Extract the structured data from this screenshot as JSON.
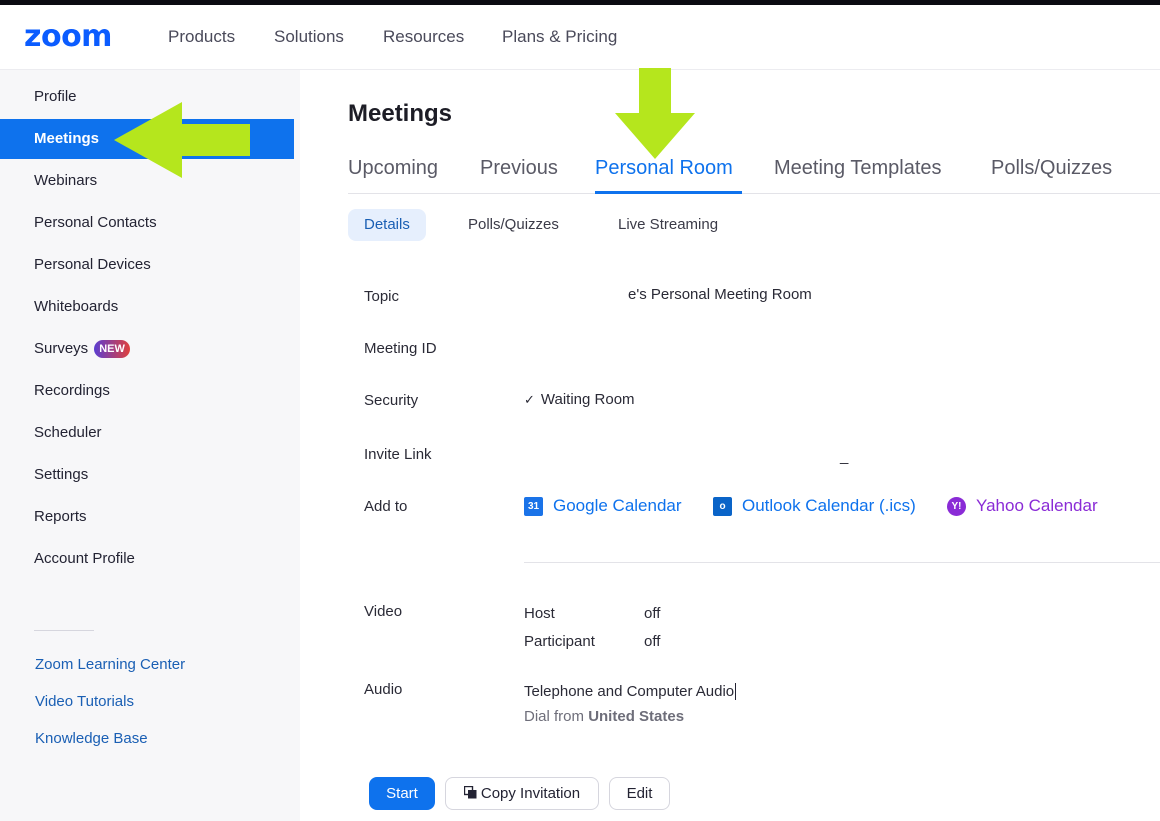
{
  "header": {
    "logo": "zoom",
    "nav": [
      "Products",
      "Solutions",
      "Resources",
      "Plans & Pricing"
    ]
  },
  "sidebar": {
    "items": [
      {
        "label": "Profile"
      },
      {
        "label": "Meetings",
        "active": true
      },
      {
        "label": "Webinars"
      },
      {
        "label": "Personal Contacts"
      },
      {
        "label": "Personal Devices"
      },
      {
        "label": "Whiteboards"
      },
      {
        "label": "Surveys",
        "badge": "NEW"
      },
      {
        "label": "Recordings"
      },
      {
        "label": "Scheduler"
      },
      {
        "label": "Settings"
      },
      {
        "label": "Reports"
      },
      {
        "label": "Account Profile"
      }
    ],
    "links": [
      "Zoom Learning Center",
      "Video Tutorials",
      "Knowledge Base"
    ]
  },
  "main": {
    "title": "Meetings",
    "tabs": [
      "Upcoming",
      "Previous",
      "Personal Room",
      "Meeting Templates",
      "Polls/Quizzes"
    ],
    "active_tab": "Personal Room",
    "subtabs": [
      "Details",
      "Polls/Quizzes",
      "Live Streaming"
    ],
    "active_subtab": "Details",
    "fields": {
      "topic_label": "Topic",
      "topic_value": "e's Personal Meeting Room",
      "meeting_id_label": "Meeting ID",
      "security_label": "Security",
      "security_check": "✓",
      "security_value": "Waiting Room",
      "invite_link_label": "Invite Link",
      "invite_link_value": "_",
      "add_to_label": "Add to",
      "calendars": [
        "Google Calendar",
        "Outlook Calendar (.ics)",
        "Yahoo Calendar"
      ],
      "calendar_icons": [
        "google-calendar-icon",
        "outlook-icon",
        "yahoo-icon"
      ],
      "google_icon_text": "31",
      "outlook_icon_text": "o",
      "yahoo_icon_text": "Y!",
      "video_label": "Video",
      "video_host_label": "Host",
      "video_host_value": "off",
      "video_participant_label": "Participant",
      "video_participant_value": "off",
      "audio_label": "Audio",
      "audio_value": "Telephone and Computer Audio",
      "dial_from_prefix": "Dial from",
      "dial_from_country": "United States"
    },
    "buttons": {
      "start": "Start",
      "copy": "Copy Invitation",
      "edit": "Edit"
    }
  },
  "colors": {
    "accent": "#0e72ed",
    "arrow": "#b5e61d",
    "yahoo": "#8a2bd6"
  }
}
